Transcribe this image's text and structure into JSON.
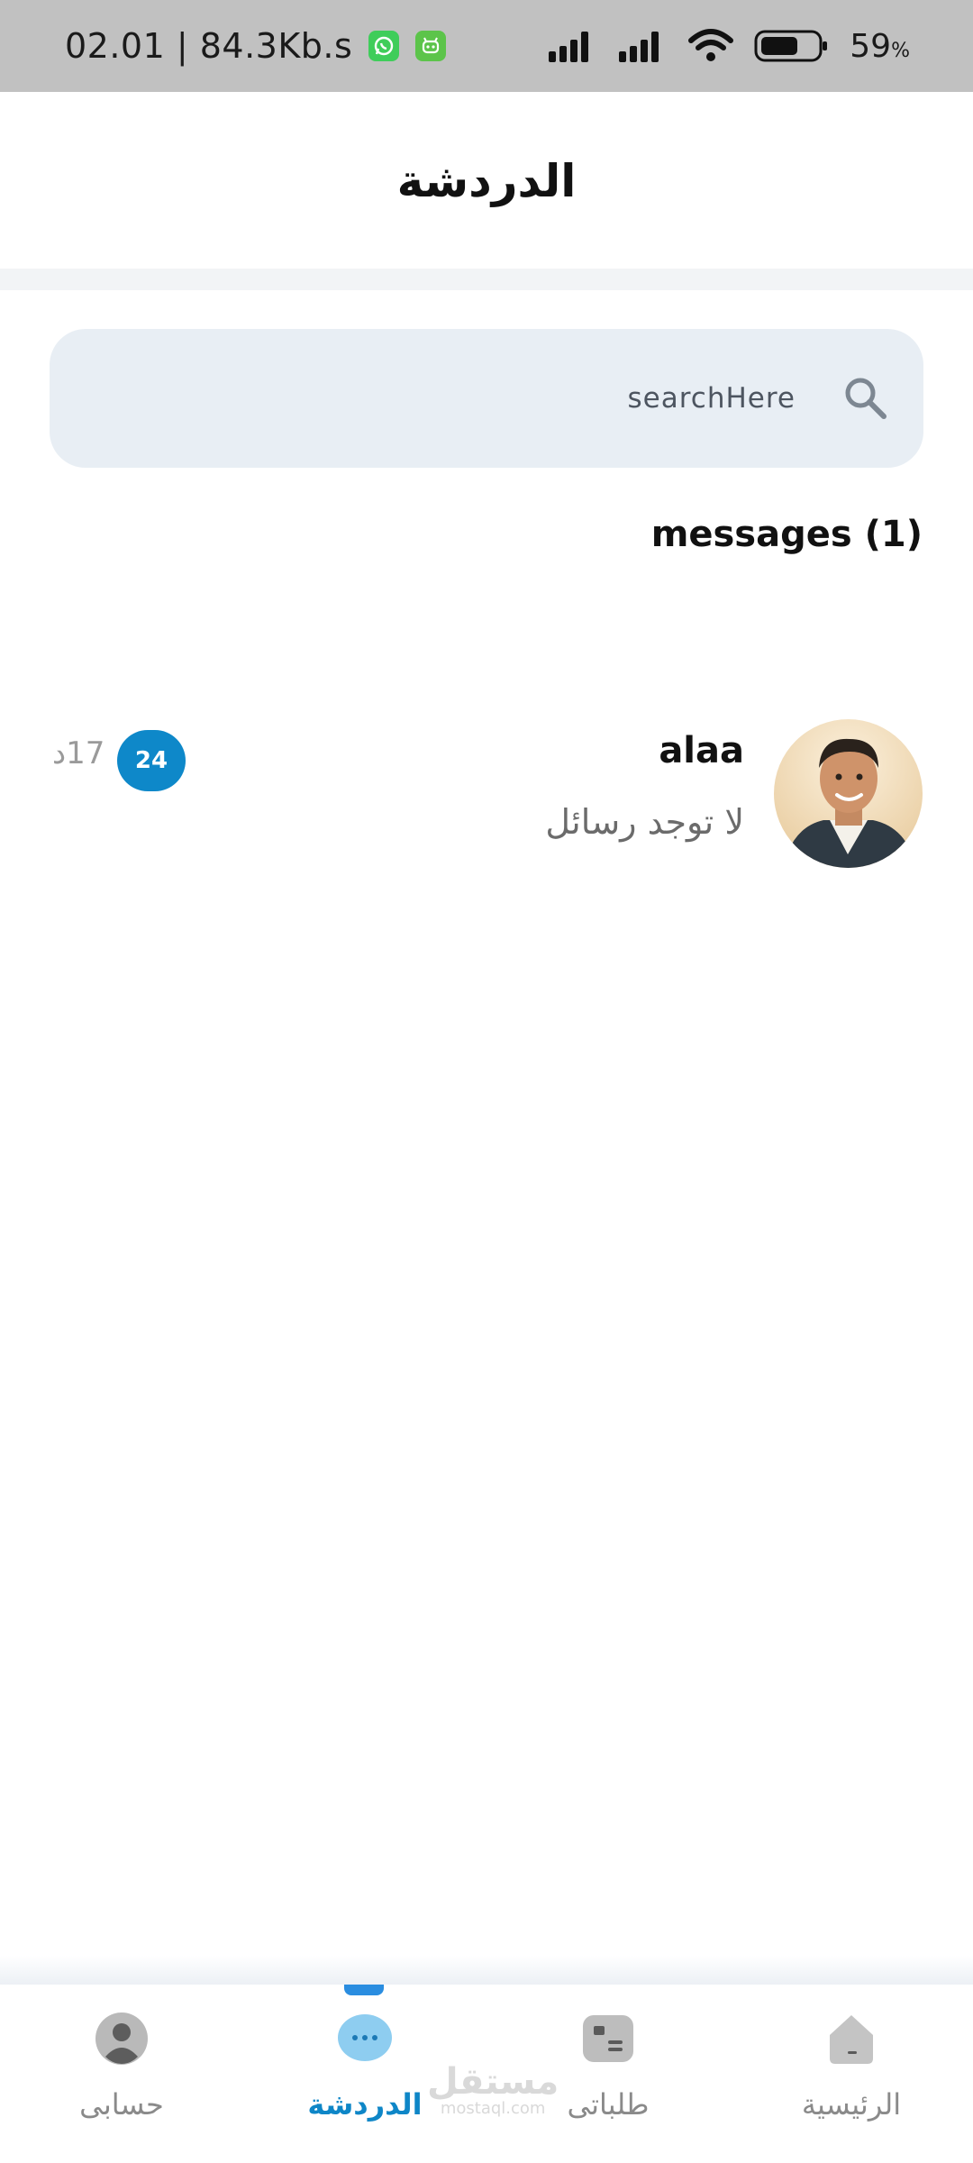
{
  "status_bar": {
    "time_speed": "02.01 | 84.3Kb.s",
    "battery_percent": "59",
    "battery_unit": "%",
    "app_icons": [
      "whatsapp-icon",
      "android-app-icon"
    ],
    "signal_icons": [
      "signal-icon",
      "signal-icon",
      "wifi-icon",
      "battery-icon"
    ]
  },
  "header": {
    "title": "الدردشة"
  },
  "search": {
    "placeholder": "searchHere"
  },
  "messages": {
    "heading": "messages (1)"
  },
  "chats": [
    {
      "name": "alaa",
      "preview": "لا توجد رسائل",
      "unread": "24",
      "time": "17د"
    }
  ],
  "bottom_nav": {
    "items": [
      {
        "label": "حسابى",
        "icon": "profile-icon",
        "active": false
      },
      {
        "label": "الدردشة",
        "icon": "chat-icon",
        "active": true
      },
      {
        "label": "طلباتى",
        "icon": "orders-icon",
        "active": false
      },
      {
        "label": "الرئيسية",
        "icon": "home-icon",
        "active": false
      }
    ]
  },
  "watermark": {
    "main": "مستقل",
    "sub": "mostaql.com"
  },
  "colors": {
    "accent": "#0e88c9",
    "search_bg": "#e8eef4",
    "status_bar_bg": "#c1c1c1"
  }
}
